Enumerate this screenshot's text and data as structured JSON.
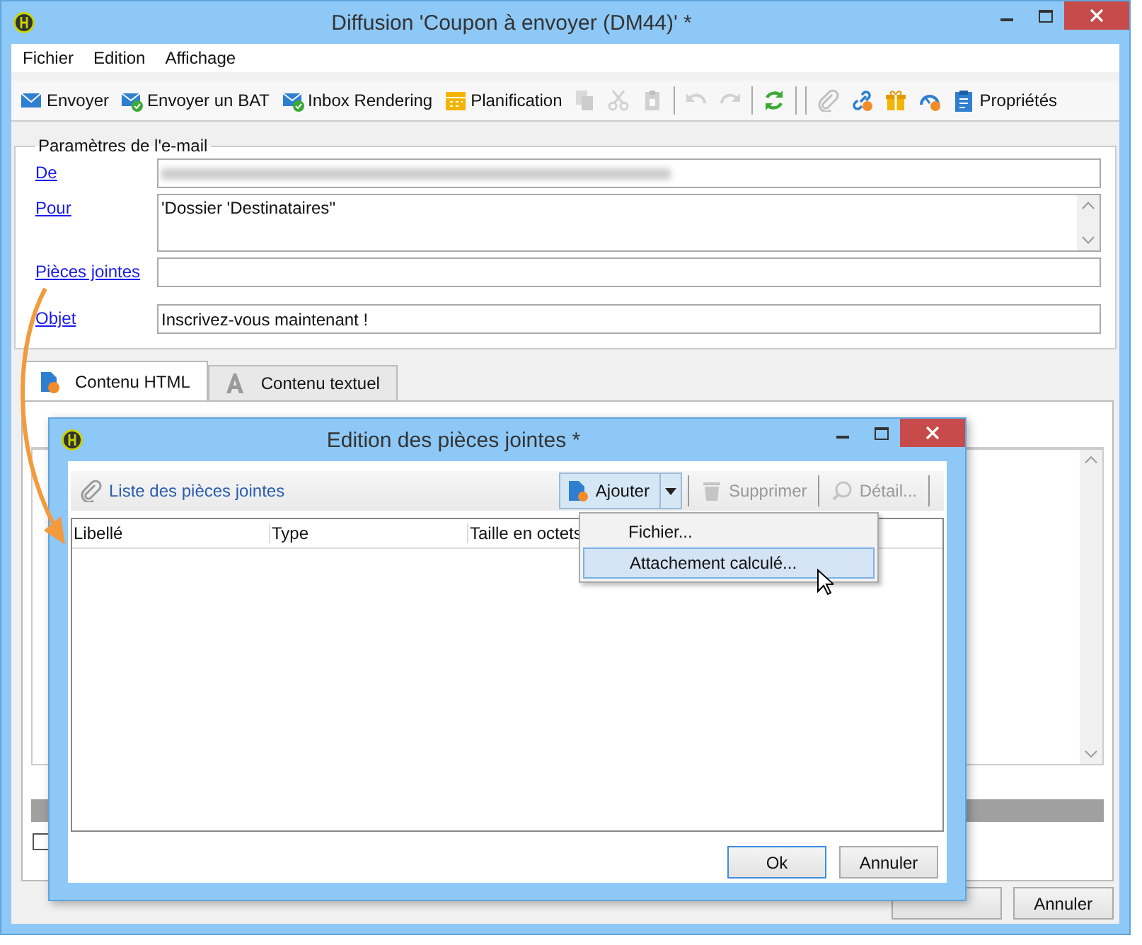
{
  "window": {
    "title": "Diffusion 'Coupon à envoyer (DM44)' *"
  },
  "menu": [
    "Fichier",
    "Edition",
    "Affichage"
  ],
  "toolbar": [
    {
      "kind": "button",
      "label": "Envoyer",
      "disabled": false
    },
    {
      "kind": "button",
      "label": "Envoyer un BAT",
      "disabled": false
    },
    {
      "kind": "button",
      "label": "Inbox Rendering",
      "disabled": false
    },
    {
      "kind": "button",
      "label": "Planification",
      "disabled": false
    },
    {
      "kind": "icon",
      "disabled": true
    },
    {
      "kind": "icon",
      "disabled": true
    },
    {
      "kind": "icon",
      "disabled": true
    },
    {
      "kind": "separator"
    },
    {
      "kind": "icon",
      "disabled": true
    },
    {
      "kind": "icon",
      "disabled": true
    },
    {
      "kind": "separator"
    },
    {
      "kind": "icon",
      "disabled": false
    },
    {
      "kind": "separator"
    },
    {
      "kind": "separator"
    },
    {
      "kind": "icon",
      "disabled": true
    },
    {
      "kind": "icon",
      "disabled": false
    },
    {
      "kind": "icon",
      "disabled": false
    },
    {
      "kind": "icon",
      "disabled": false
    },
    {
      "kind": "button",
      "label": "Propriétés",
      "disabled": false
    }
  ],
  "email_params": {
    "legend": "Paramètres de l'e-mail",
    "fields": [
      {
        "kind": "line",
        "label": "De",
        "redacted": true
      },
      {
        "kind": "multiline",
        "label": "Pour",
        "value": "'Dossier 'Destinataires''"
      },
      {
        "kind": "line",
        "label": "Pièces jointes"
      },
      {
        "kind": "line",
        "label": "Objet",
        "value": "Inscrivez-vous maintenant !"
      }
    ]
  },
  "tabs": [
    {
      "label": "Contenu HTML",
      "selected": true
    },
    {
      "label": "Contenu textuel",
      "selected": false
    }
  ],
  "panel": {
    "checkbox": {
      "checked": false
    }
  },
  "buttons": [
    "Annuler"
  ],
  "dialog": {
    "title": "Edition des pièces jointes *",
    "list_title": "Liste des pièces jointes",
    "actions": [
      {
        "kind": "split",
        "label": "Ajouter",
        "pressed": true
      },
      {
        "kind": "button",
        "label": "Supprimer",
        "disabled": true
      },
      {
        "kind": "button",
        "label": "Détail...",
        "disabled": true
      }
    ],
    "columns": [
      "Libellé",
      "Type",
      "Taille en octets"
    ],
    "add_menu": [
      {
        "label": "Fichier...",
        "selected": false
      },
      {
        "label": "Attachement calculé...",
        "selected": true
      }
    ],
    "buttons": [
      {
        "label": "Ok",
        "default": true
      },
      {
        "label": "Annuler",
        "default": false
      }
    ]
  }
}
